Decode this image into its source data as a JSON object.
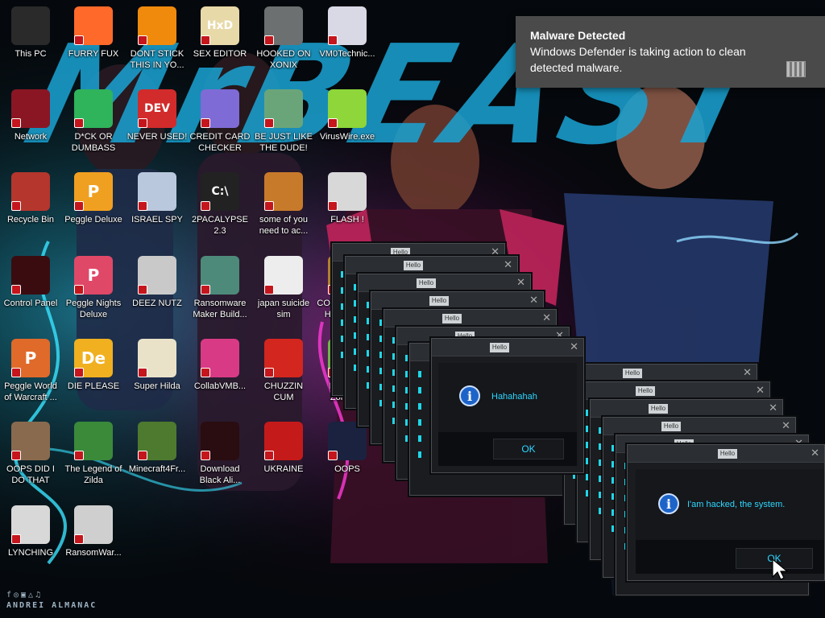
{
  "wallpaper": {
    "sign_glyphs": "f◎▣△♫",
    "signature": "ANDREI ALMANAC",
    "accent_color": "#1aa4d4"
  },
  "desktop_icons": [
    {
      "label": "This PC",
      "icon": "computer-icon",
      "color": "#2a2a2a"
    },
    {
      "label": "FURRY FUX",
      "icon": "firefox-icon",
      "color": "#ff6a2a"
    },
    {
      "label": "DONT STICK THIS IN YO...",
      "icon": "vlc-cone-icon",
      "color": "#f08a0c"
    },
    {
      "label": "SEX EDITOR",
      "icon": "hex-editor-icon",
      "color": "#e8d9a8",
      "text": "HxD"
    },
    {
      "label": "HOOKED ON XONIX",
      "icon": "xonix-game-icon",
      "color": "#6c7070"
    },
    {
      "label": "VM0Technic...",
      "icon": "doctor-icon",
      "color": "#d9d9e6"
    },
    {
      "label": "Network",
      "icon": "network-orb-icon",
      "color": "#8a1624"
    },
    {
      "label": "D*CK OR DUMBASS",
      "icon": "spreadsheet-icon",
      "color": "#2fb35b"
    },
    {
      "label": "NEVER USED!",
      "icon": "dev-cpp-icon",
      "color": "#d12b2b",
      "text": "DEV"
    },
    {
      "label": "CREDIT CARD CHECKER",
      "icon": "credit-card-icon",
      "color": "#7f6bd6"
    },
    {
      "label": "BE JUST LIKE THE DUDE!",
      "icon": "santa-icon",
      "color": "#6aa57a"
    },
    {
      "label": "VirusWire.exe",
      "icon": "lime-icon",
      "color": "#8ed63a"
    },
    {
      "label": "Recycle Bin",
      "icon": "recycle-bin-icon",
      "color": "#b5362d"
    },
    {
      "label": "Peggle Deluxe",
      "icon": "peggle-icon",
      "color": "#f0a020",
      "text": "P"
    },
    {
      "label": "ISRAEL SPY",
      "icon": "spy-icon",
      "color": "#b9c8dc"
    },
    {
      "label": "2PACALYPSE 2.3",
      "icon": "terminal-icon",
      "color": "#222",
      "text": "C:\\"
    },
    {
      "label": "some of you need to ac...",
      "icon": "dog-icon",
      "color": "#c87a2b"
    },
    {
      "label": "FLASH !",
      "icon": "flash-icon",
      "color": "#d8d8d8"
    },
    {
      "label": "Control Panel",
      "icon": "control-panel-icon",
      "color": "#3a0c10"
    },
    {
      "label": "Peggle Nights Deluxe",
      "icon": "peggle-nights-icon",
      "color": "#e04868",
      "text": "P"
    },
    {
      "label": "DEEZ NUTZ",
      "icon": "windows-stack-icon",
      "color": "#c9c9c9"
    },
    {
      "label": "Ransomware Maker Build...",
      "icon": "app-window-icon",
      "color": "#4e8a7a"
    },
    {
      "label": "japan suicide sim",
      "icon": "document-icon",
      "color": "#ededed"
    },
    {
      "label": "COMMUNISTS HATE THIS G...",
      "icon": "money-bag-icon",
      "color": "#b08030",
      "text": "$"
    },
    {
      "label": "Peggle World of Warcraft ...",
      "icon": "peggle-wow-icon",
      "color": "#e06a2a",
      "text": "P"
    },
    {
      "label": "DIE PLEASE",
      "icon": "adobe-de-icon",
      "color": "#f0b020",
      "text": "De"
    },
    {
      "label": "Super Hilda",
      "icon": "pixel-cat-icon",
      "color": "#e9e2c8"
    },
    {
      "label": "CollabVMB...",
      "icon": "collab-vm-icon",
      "color": "#d83a86"
    },
    {
      "label": "CHUZZIN CUM",
      "icon": "chuzzle-icon",
      "color": "#d3261e"
    },
    {
      "label": "Plants vs Zombies",
      "icon": "plant-icon",
      "color": "#6fb14a"
    },
    {
      "label": "OOPS DID I DO THAT",
      "icon": "portrait-icon",
      "color": "#8a6a4e"
    },
    {
      "label": "The Legend of Zilda",
      "icon": "link-sprite-icon",
      "color": "#3a8a3a"
    },
    {
      "label": "Minecraft4Fr...",
      "icon": "grass-block-icon",
      "color": "#4d7a2e"
    },
    {
      "label": "Download Black Ali...",
      "icon": "black-orb-icon",
      "color": "#2a0d10"
    },
    {
      "label": "UKRAINE",
      "icon": "radiation-icon",
      "color": "#c51a1a"
    },
    {
      "label": "OOPS",
      "icon": "cursor-file-icon",
      "color": "#1a2240"
    },
    {
      "label": "LYNCHING",
      "icon": "rope-icon",
      "color": "#d8d8d8"
    },
    {
      "label": "RansomWar...",
      "icon": "skull-icon",
      "color": "#cfcfcf"
    }
  ],
  "toast": {
    "title": "Malware Detected",
    "body": "Windows Defender is taking action to clean detected malware.",
    "icon": "defender-icon"
  },
  "dialogs": {
    "title": "Hello",
    "main": {
      "message": "Hahahahah",
      "ok_label": "OK",
      "icon": "info-icon"
    },
    "second": {
      "message": "I'am hacked, the system.",
      "ok_label": "OK",
      "icon": "info-icon"
    }
  }
}
